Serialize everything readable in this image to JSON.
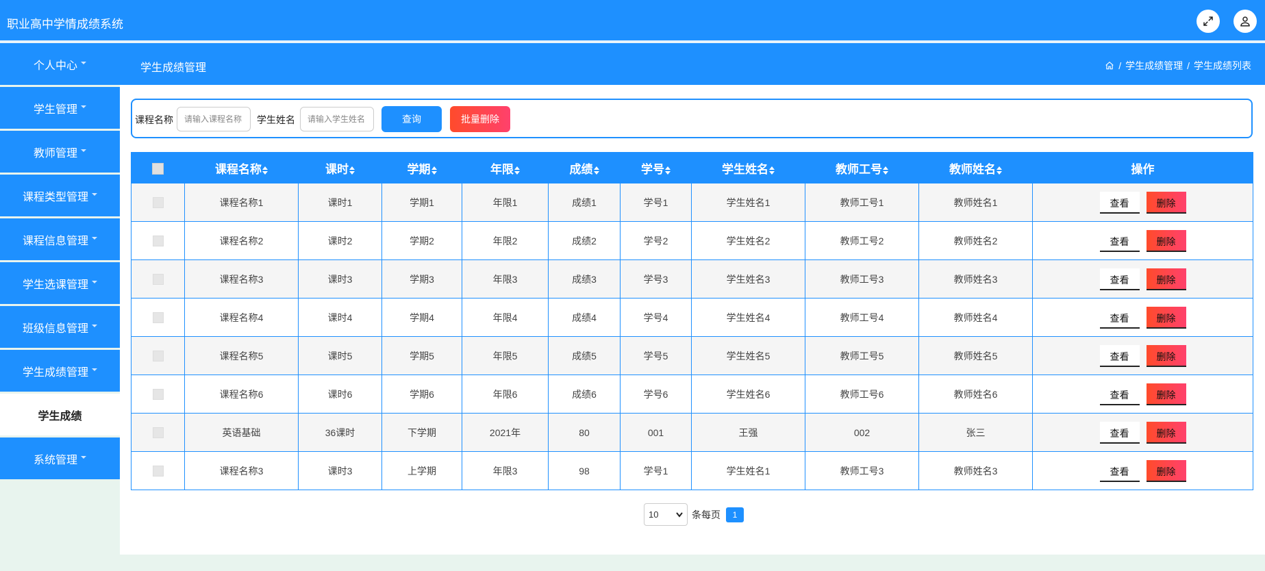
{
  "app": {
    "title": "职业高中学情成绩系统"
  },
  "topbar": {
    "fullscreen_icon": "fullscreen-icon",
    "user_icon": "user-icon"
  },
  "sidebar": {
    "items": [
      {
        "label": "个人中心"
      },
      {
        "label": "学生管理"
      },
      {
        "label": "教师管理"
      },
      {
        "label": "课程类型管理"
      },
      {
        "label": "课程信息管理"
      },
      {
        "label": "学生选课管理"
      },
      {
        "label": "班级信息管理"
      },
      {
        "label": "学生成绩管理"
      }
    ],
    "active_sub": {
      "label": "学生成绩"
    },
    "last": {
      "label": "系统管理"
    }
  },
  "header": {
    "title": "学生成绩管理",
    "breadcrumb": [
      "学生成绩管理",
      "学生成绩列表"
    ],
    "separator": "/"
  },
  "search": {
    "course_label": "课程名称",
    "course_placeholder": "请输入课程名称",
    "student_label": "学生姓名",
    "student_placeholder": "请输入学生姓名",
    "query_label": "查询",
    "batch_delete_label": "批量删除"
  },
  "table": {
    "headers": [
      "课程名称",
      "课时",
      "学期",
      "年限",
      "成绩",
      "学号",
      "学生姓名",
      "教师工号",
      "教师姓名"
    ],
    "ops_header": "操作",
    "view_label": "查看",
    "delete_label": "删除",
    "rows": [
      [
        "课程名称1",
        "课时1",
        "学期1",
        "年限1",
        "成绩1",
        "学号1",
        "学生姓名1",
        "教师工号1",
        "教师姓名1"
      ],
      [
        "课程名称2",
        "课时2",
        "学期2",
        "年限2",
        "成绩2",
        "学号2",
        "学生姓名2",
        "教师工号2",
        "教师姓名2"
      ],
      [
        "课程名称3",
        "课时3",
        "学期3",
        "年限3",
        "成绩3",
        "学号3",
        "学生姓名3",
        "教师工号3",
        "教师姓名3"
      ],
      [
        "课程名称4",
        "课时4",
        "学期4",
        "年限4",
        "成绩4",
        "学号4",
        "学生姓名4",
        "教师工号4",
        "教师姓名4"
      ],
      [
        "课程名称5",
        "课时5",
        "学期5",
        "年限5",
        "成绩5",
        "学号5",
        "学生姓名5",
        "教师工号5",
        "教师姓名5"
      ],
      [
        "课程名称6",
        "课时6",
        "学期6",
        "年限6",
        "成绩6",
        "学号6",
        "学生姓名6",
        "教师工号6",
        "教师姓名6"
      ],
      [
        "英语基础",
        "36课时",
        "下学期",
        "2021年",
        "80",
        "001",
        "王强",
        "002",
        "张三"
      ],
      [
        "课程名称3",
        "课时3",
        "上学期",
        "年限3",
        "98",
        "学号1",
        "学生姓名1",
        "教师工号3",
        "教师姓名3"
      ]
    ]
  },
  "pagination": {
    "page_size": "10",
    "per_page_label": "条每页",
    "current_page": "1"
  },
  "colors": {
    "primary": "#1e90ff",
    "danger_start": "#ff4b2b",
    "danger_end": "#ff416c",
    "background": "#e8f4ee"
  }
}
